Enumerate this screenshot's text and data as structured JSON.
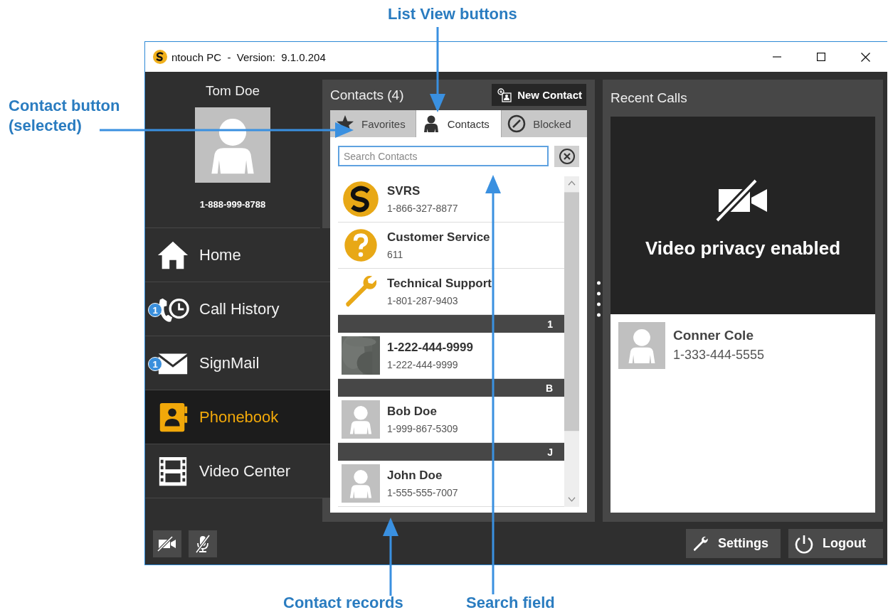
{
  "window": {
    "title": "ntouch PC  -  Version:  9.1.0.204"
  },
  "user": {
    "name": "Tom Doe",
    "phone": "1-888-999-8788"
  },
  "nav": [
    {
      "label": "Home",
      "selected": false
    },
    {
      "label": "Call History",
      "selected": false,
      "badge": "1"
    },
    {
      "label": "SignMail",
      "selected": false,
      "badge": "1"
    },
    {
      "label": "Phonebook",
      "selected": true
    },
    {
      "label": "Video Center",
      "selected": false
    }
  ],
  "contacts_panel": {
    "title": "Contacts (4)",
    "new_button": "New Contact",
    "tabs": [
      {
        "label": "Favorites",
        "selected": false
      },
      {
        "label": "Contacts",
        "selected": true
      },
      {
        "label": "Blocked",
        "selected": false
      }
    ],
    "search": {
      "placeholder": "Search Contacts"
    },
    "rows": [
      {
        "kind": "logo",
        "name": "SVRS",
        "number": "1-866-327-8877"
      },
      {
        "kind": "help",
        "name": "Customer Service",
        "number": "611"
      },
      {
        "kind": "tool",
        "name": "Technical Support",
        "number": "1-801-287-9403"
      },
      {
        "kind": "header",
        "letter": "1"
      },
      {
        "name": "1-222-444-9999",
        "number": "1-222-444-9999"
      },
      {
        "kind": "header",
        "letter": "B"
      },
      {
        "kind": "person",
        "name": "Bob Doe",
        "number": "1-999-867-5309"
      },
      {
        "kind": "header",
        "letter": "J"
      },
      {
        "kind": "person",
        "name": "John Doe",
        "number": "1-555-555-7007"
      }
    ]
  },
  "recent_panel": {
    "title": "Recent Calls",
    "video_status": "Video privacy enabled",
    "calls": [
      {
        "name": "Conner Cole",
        "number": "1-333-444-5555"
      }
    ]
  },
  "footer": {
    "settings": "Settings",
    "logout": "Logout"
  },
  "callouts": [
    {
      "text": "List View buttons"
    },
    {
      "text": "Contact button (selected)"
    },
    {
      "text": "Contact records"
    },
    {
      "text": "Search field"
    }
  ]
}
